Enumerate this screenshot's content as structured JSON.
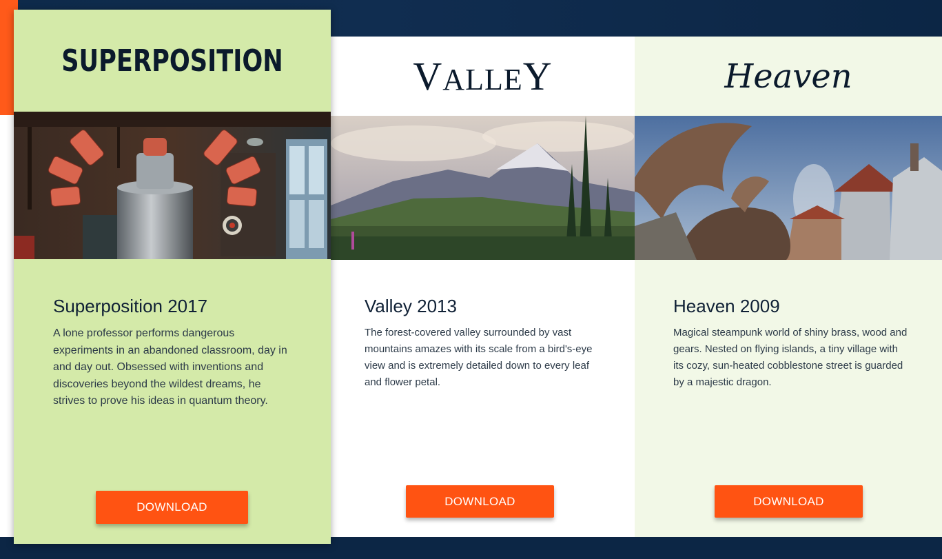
{
  "cards": [
    {
      "logo": "SUPERPOSITION",
      "title": "Superposition 2017",
      "description": "A lone professor performs dangerous experiments in an abandoned classroom, day in and day out. Obsessed with inventions and discoveries beyond the wildest dreams, he strives to prove his ideas in quantum theory.",
      "button_label": "DOWNLOAD",
      "background": "#d4eaa9"
    },
    {
      "logo_big_v": "V",
      "logo_middle": "ALLE",
      "logo_big_y": "Y",
      "title": "Valley 2013",
      "description": "The forest-covered valley surrounded by vast mountains amazes with its scale from a bird's-eye view and is extremely detailed down to every leaf and flower petal.",
      "button_label": "DOWNLOAD",
      "background": "#ffffff"
    },
    {
      "logo": "Heaven",
      "title": "Heaven 2009",
      "description": "Magical steampunk world of shiny brass, wood and gears. Nested on flying islands, a tiny village with its cozy, sun-heated cobblestone street is guarded by a majestic dragon.",
      "button_label": "DOWNLOAD",
      "background": "#f2f8e7"
    }
  ],
  "colors": {
    "accent": "#ff5312",
    "navy": "#0c2645",
    "text": "#0f2035"
  }
}
